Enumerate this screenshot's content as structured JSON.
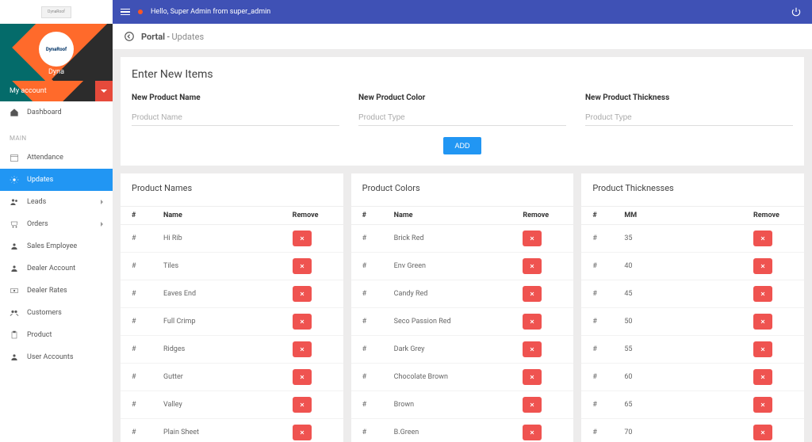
{
  "topbar": {
    "greeting": "Hello, Super Admin from super_admin"
  },
  "sidebar": {
    "logo_text": "DynaRoof",
    "username": "Dyna",
    "account_label": "My account",
    "section_main": "MAIN",
    "items": [
      {
        "label": "Dashboard",
        "icon": "home"
      },
      {
        "label": "Attendance",
        "icon": "calendar"
      },
      {
        "label": "Updates",
        "icon": "gear",
        "active": true
      },
      {
        "label": "Leads",
        "icon": "users",
        "expandable": true
      },
      {
        "label": "Orders",
        "icon": "cart",
        "expandable": true
      },
      {
        "label": "Sales Employee",
        "icon": "person"
      },
      {
        "label": "Dealer Account",
        "icon": "person"
      },
      {
        "label": "Dealer Rates",
        "icon": "money"
      },
      {
        "label": "Customers",
        "icon": "group"
      },
      {
        "label": "Product",
        "icon": "clipboard"
      },
      {
        "label": "User Accounts",
        "icon": "person"
      }
    ]
  },
  "breadcrumb": {
    "portal": "Portal",
    "sep": " - ",
    "page": "Updates"
  },
  "form": {
    "title": "Enter New Items",
    "name_label": "New Product Name",
    "name_placeholder": "Product Name",
    "color_label": "New Product Color",
    "color_placeholder": "Product Type",
    "thick_label": "New Product Thickness",
    "thick_placeholder": "Product Type",
    "add_btn": "ADD"
  },
  "tables": {
    "names": {
      "title": "Product Names",
      "col_idx": "#",
      "col_name": "Name",
      "col_act": "Remove",
      "rows": [
        {
          "name": "Hi Rib"
        },
        {
          "name": "Tiles"
        },
        {
          "name": "Eaves End"
        },
        {
          "name": "Full Crimp"
        },
        {
          "name": "Ridges"
        },
        {
          "name": "Gutter"
        },
        {
          "name": "Valley"
        },
        {
          "name": "Plain Sheet"
        }
      ]
    },
    "colors": {
      "title": "Product Colors",
      "col_idx": "#",
      "col_name": "Name",
      "col_act": "Remove",
      "rows": [
        {
          "name": "Brick Red"
        },
        {
          "name": "Env Green"
        },
        {
          "name": "Candy Red"
        },
        {
          "name": "Seco Passion Red"
        },
        {
          "name": "Dark Grey"
        },
        {
          "name": "Chocolate Brown"
        },
        {
          "name": "Brown"
        },
        {
          "name": "B.Green"
        }
      ]
    },
    "thick": {
      "title": "Product Thicknesses",
      "col_idx": "#",
      "col_name": "MM",
      "col_act": "Remove",
      "rows": [
        {
          "name": "35"
        },
        {
          "name": "40"
        },
        {
          "name": "45"
        },
        {
          "name": "50"
        },
        {
          "name": "55"
        },
        {
          "name": "60"
        },
        {
          "name": "65"
        },
        {
          "name": "70"
        }
      ]
    }
  }
}
